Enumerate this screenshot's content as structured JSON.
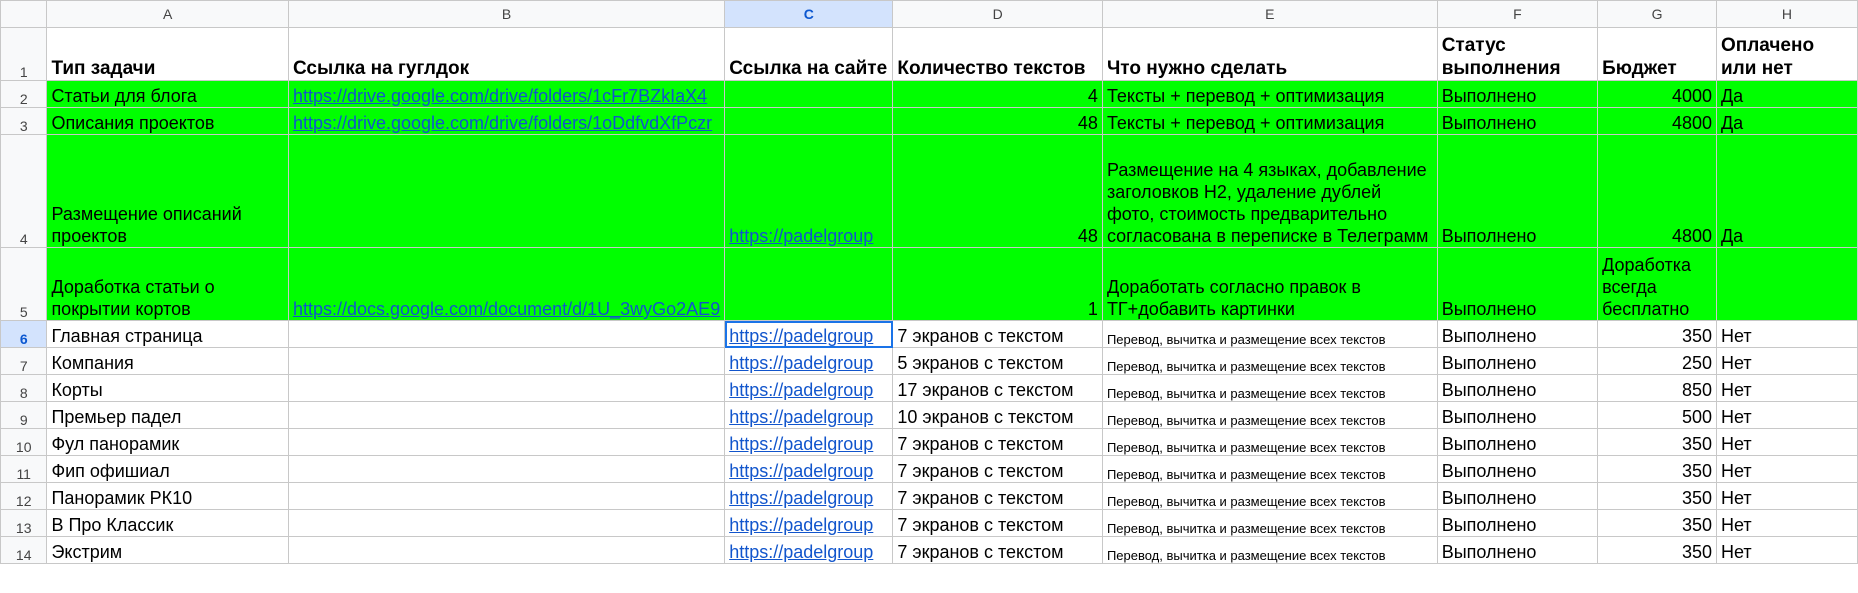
{
  "columns": [
    "A",
    "B",
    "C",
    "D",
    "E",
    "F",
    "G",
    "H"
  ],
  "selected_column": "C",
  "header_row": {
    "number": "1",
    "cells": [
      "Тип задачи",
      "Ссылка на гуглдок",
      "Ссылка на сайте",
      "Количество текстов",
      "Что нужно сделать",
      "Статус выполнения",
      "Бюджет",
      "Оплачено или нет"
    ]
  },
  "rows": [
    {
      "number": "2",
      "task": "Статьи для блога",
      "doc_link": "https://drive.google.com/drive/folders/1cFr7BZkIaX4",
      "site_link": "",
      "count": "4",
      "todo": "Тексты + перевод + оптимизация",
      "status": "Выполнено",
      "budget": "4000",
      "paid": "Да"
    },
    {
      "number": "3",
      "task": "Описания проектов",
      "doc_link": "https://drive.google.com/drive/folders/1oDdfvdXfPczr",
      "site_link": "",
      "count": "48",
      "todo": "Тексты + перевод + оптимизация",
      "status": "Выполнено",
      "budget": "4800",
      "paid": "Да"
    },
    {
      "number": "4",
      "task": "Размещение описаний проектов",
      "doc_link": "",
      "site_link": "https://padelgroup",
      "count": "48",
      "todo": "Размещение на 4 языках, добавление заголовков Н2, удаление дублей фото, стоимость предварительно согласована в переписке в Телеграмм",
      "status": "Выполнено",
      "budget": "4800",
      "paid": "Да"
    },
    {
      "number": "5",
      "task": "Доработка статьи о покрытии кортов",
      "doc_link": "https://docs.google.com/document/d/1U_3wyGo2AE9",
      "site_link": "",
      "count": "1",
      "todo": "Доработать согласно правок в ТГ+добавить картинки",
      "status": "Выполнено",
      "budget": "Доработка всегда бесплатно",
      "paid": ""
    },
    {
      "number": "6",
      "task": "Главная страница",
      "doc_link": "",
      "site_link": "https://padelgroup",
      "count": "7 экранов с текстом",
      "todo": "Перевод, вычитка и размещение всех текстов",
      "status": "Выполнено",
      "budget": "350",
      "paid": "Нет"
    },
    {
      "number": "7",
      "task": "Компания",
      "doc_link": "",
      "site_link": "https://padelgroup",
      "count": "5 экранов с текстом",
      "todo": "Перевод, вычитка и размещение всех текстов",
      "status": "Выполнено",
      "budget": "250",
      "paid": "Нет"
    },
    {
      "number": "8",
      "task": "Корты",
      "doc_link": "",
      "site_link": "https://padelgroup",
      "count": "17 экранов с текстом",
      "todo": "Перевод, вычитка и размещение всех текстов",
      "status": "Выполнено",
      "budget": "850",
      "paid": "Нет"
    },
    {
      "number": "9",
      "task": "Премьер падел",
      "doc_link": "",
      "site_link": "https://padelgroup",
      "count": "10 экранов с текстом",
      "todo": "Перевод, вычитка и размещение всех текстов",
      "status": "Выполнено",
      "budget": "500",
      "paid": "Нет"
    },
    {
      "number": "10",
      "task": "Фул панорамик",
      "doc_link": "",
      "site_link": "https://padelgroup",
      "count": "7 экранов с текстом",
      "todo": "Перевод, вычитка и размещение всех текстов",
      "status": "Выполнено",
      "budget": "350",
      "paid": "Нет"
    },
    {
      "number": "11",
      "task": "Фип офишиал",
      "doc_link": "",
      "site_link": "https://padelgroup",
      "count": "7 экранов с текстом",
      "todo": "Перевод, вычитка и размещение всех текстов",
      "status": "Выполнено",
      "budget": "350",
      "paid": "Нет"
    },
    {
      "number": "12",
      "task": "Панорамик РК10",
      "doc_link": "",
      "site_link": "https://padelgroup",
      "count": "7 экранов с текстом",
      "todo": "Перевод, вычитка и размещение всех текстов",
      "status": "Выполнено",
      "budget": "350",
      "paid": "Нет"
    },
    {
      "number": "13",
      "task": "В Про Классик",
      "doc_link": "",
      "site_link": "https://padelgroup",
      "count": "7 экранов с текстом",
      "todo": "Перевод, вычитка и размещение всех текстов",
      "status": "Выполнено",
      "budget": "350",
      "paid": "Нет"
    },
    {
      "number": "14",
      "task": "Экстрим",
      "doc_link": "",
      "site_link": "https://padelgroup",
      "count": "7 экранов с текстом",
      "todo": "Перевод, вычитка и размещение всех текстов",
      "status": "Выполнено",
      "budget": "350",
      "paid": "Нет"
    }
  ],
  "colors": {
    "highlight_green": "#00ff00",
    "link": "#1155cc",
    "selection": "#1a73e8",
    "header_bg": "#f8f9fa"
  }
}
